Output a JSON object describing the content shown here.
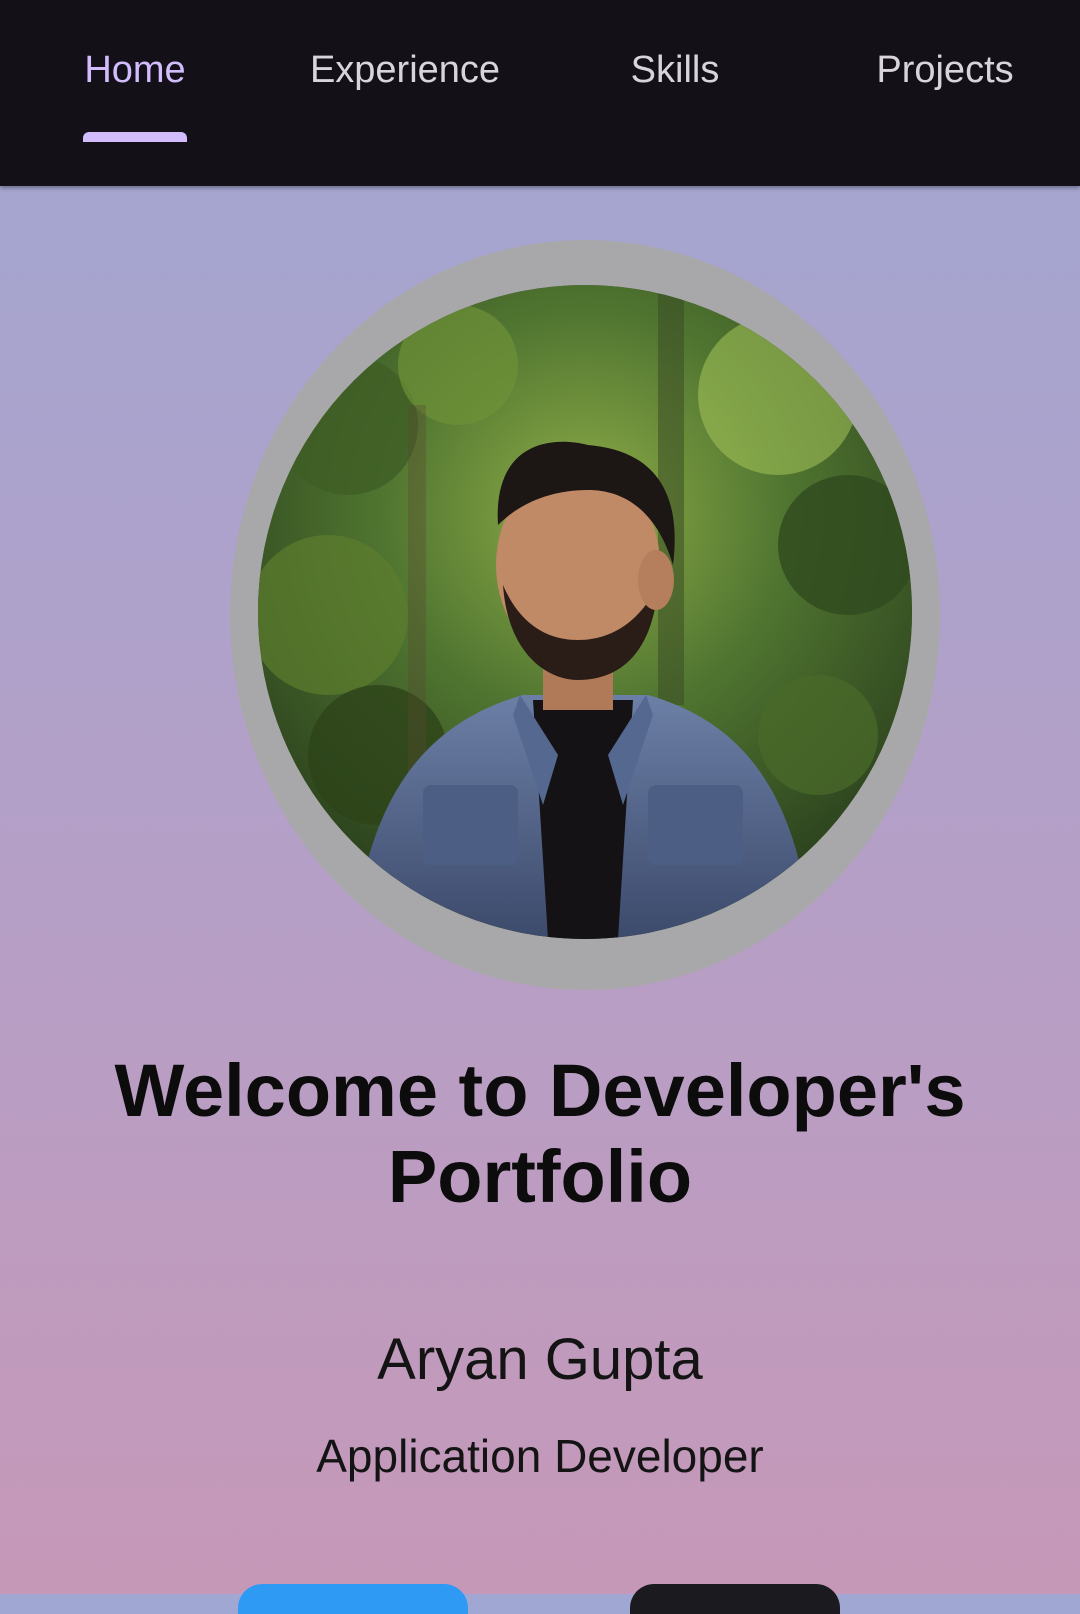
{
  "tabs": [
    {
      "label": "Home",
      "active": true
    },
    {
      "label": "Experience",
      "active": false
    },
    {
      "label": "Skills",
      "active": false
    },
    {
      "label": "Projects",
      "active": false
    }
  ],
  "hero": {
    "welcome": "Welcome to Developer's Portfolio",
    "name": "Aryan Gupta",
    "role": "Application Developer",
    "avatar": "profile-photo"
  },
  "colors": {
    "tabbar_bg": "#131018",
    "tab_active": "#d2bcfc",
    "tab_inactive": "#d9d4dc",
    "avatar_ring": "#a8a8aa",
    "gradient_top": "#a0a7d2",
    "gradient_bottom": "#c698b8",
    "button_blue": "#2e9af4",
    "button_dark": "#1b1b1f"
  }
}
